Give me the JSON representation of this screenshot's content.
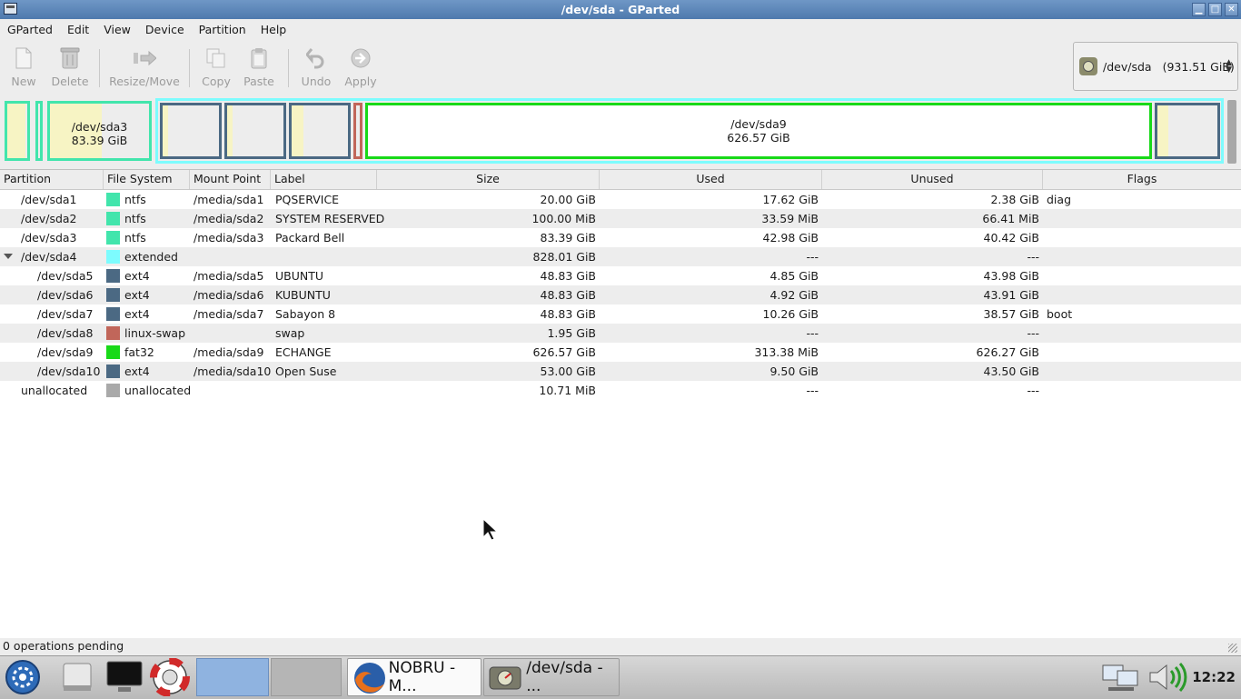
{
  "window": {
    "title": "/dev/sda - GParted"
  },
  "menu": [
    "GParted",
    "Edit",
    "View",
    "Device",
    "Partition",
    "Help"
  ],
  "toolbar": {
    "new": "New",
    "delete": "Delete",
    "resize": "Resize/Move",
    "copy": "Copy",
    "paste": "Paste",
    "undo": "Undo",
    "apply": "Apply"
  },
  "device_selector": {
    "device": "/dev/sda",
    "size": "(931.51 GiB)"
  },
  "disk_map": {
    "sda3": {
      "name": "/dev/sda3",
      "size": "83.39 GiB"
    },
    "sda9": {
      "name": "/dev/sda9",
      "size": "626.57 GiB"
    }
  },
  "columns": [
    "Partition",
    "File System",
    "Mount Point",
    "Label",
    "Size",
    "Used",
    "Unused",
    "Flags"
  ],
  "filesystem_colors": {
    "ntfs": "#42e5ac",
    "extended": "#7dfcfe",
    "ext4": "#4b6983",
    "linux-swap": "#c1665a",
    "fat32": "#18d918",
    "unallocated": "#a9a9a9"
  },
  "rows": [
    {
      "partition": "/dev/sda1",
      "fs": "ntfs",
      "mount": "/media/sda1",
      "label": "PQSERVICE",
      "size": "20.00 GiB",
      "used": "17.62 GiB",
      "unused": "2.38 GiB",
      "flags": "diag"
    },
    {
      "partition": "/dev/sda2",
      "fs": "ntfs",
      "mount": "/media/sda2",
      "label": "SYSTEM RESERVED",
      "size": "100.00 MiB",
      "used": "33.59 MiB",
      "unused": "66.41 MiB",
      "flags": ""
    },
    {
      "partition": "/dev/sda3",
      "fs": "ntfs",
      "mount": "/media/sda3",
      "label": "Packard Bell",
      "size": "83.39 GiB",
      "used": "42.98 GiB",
      "unused": "40.42 GiB",
      "flags": ""
    },
    {
      "partition": "/dev/sda4",
      "fs": "extended",
      "mount": "",
      "label": "",
      "size": "828.01 GiB",
      "used": "---",
      "unused": "---",
      "flags": ""
    },
    {
      "partition": "/dev/sda5",
      "fs": "ext4",
      "mount": "/media/sda5",
      "label": "UBUNTU",
      "size": "48.83 GiB",
      "used": "4.85 GiB",
      "unused": "43.98 GiB",
      "flags": ""
    },
    {
      "partition": "/dev/sda6",
      "fs": "ext4",
      "mount": "/media/sda6",
      "label": "KUBUNTU",
      "size": "48.83 GiB",
      "used": "4.92 GiB",
      "unused": "43.91 GiB",
      "flags": ""
    },
    {
      "partition": "/dev/sda7",
      "fs": "ext4",
      "mount": "/media/sda7",
      "label": "Sabayon 8",
      "size": "48.83 GiB",
      "used": "10.26 GiB",
      "unused": "38.57 GiB",
      "flags": "boot"
    },
    {
      "partition": "/dev/sda8",
      "fs": "linux-swap",
      "mount": "",
      "label": "swap",
      "size": "1.95 GiB",
      "used": "---",
      "unused": "---",
      "flags": ""
    },
    {
      "partition": "/dev/sda9",
      "fs": "fat32",
      "mount": "/media/sda9",
      "label": "ECHANGE",
      "size": "626.57 GiB",
      "used": "313.38 MiB",
      "unused": "626.27 GiB",
      "flags": ""
    },
    {
      "partition": "/dev/sda10",
      "fs": "ext4",
      "mount": "/media/sda10",
      "label": "Open Suse",
      "size": "53.00 GiB",
      "used": "9.50 GiB",
      "unused": "43.50 GiB",
      "flags": ""
    },
    {
      "partition": "unallocated",
      "fs": "unallocated",
      "mount": "",
      "label": "",
      "size": "10.71 MiB",
      "used": "---",
      "unused": "---",
      "flags": ""
    }
  ],
  "status": "0 operations pending",
  "taskbar": {
    "firefox_task": "NOBRU - M...",
    "gparted_task": "/dev/sda - ...",
    "clock": "12:22"
  }
}
